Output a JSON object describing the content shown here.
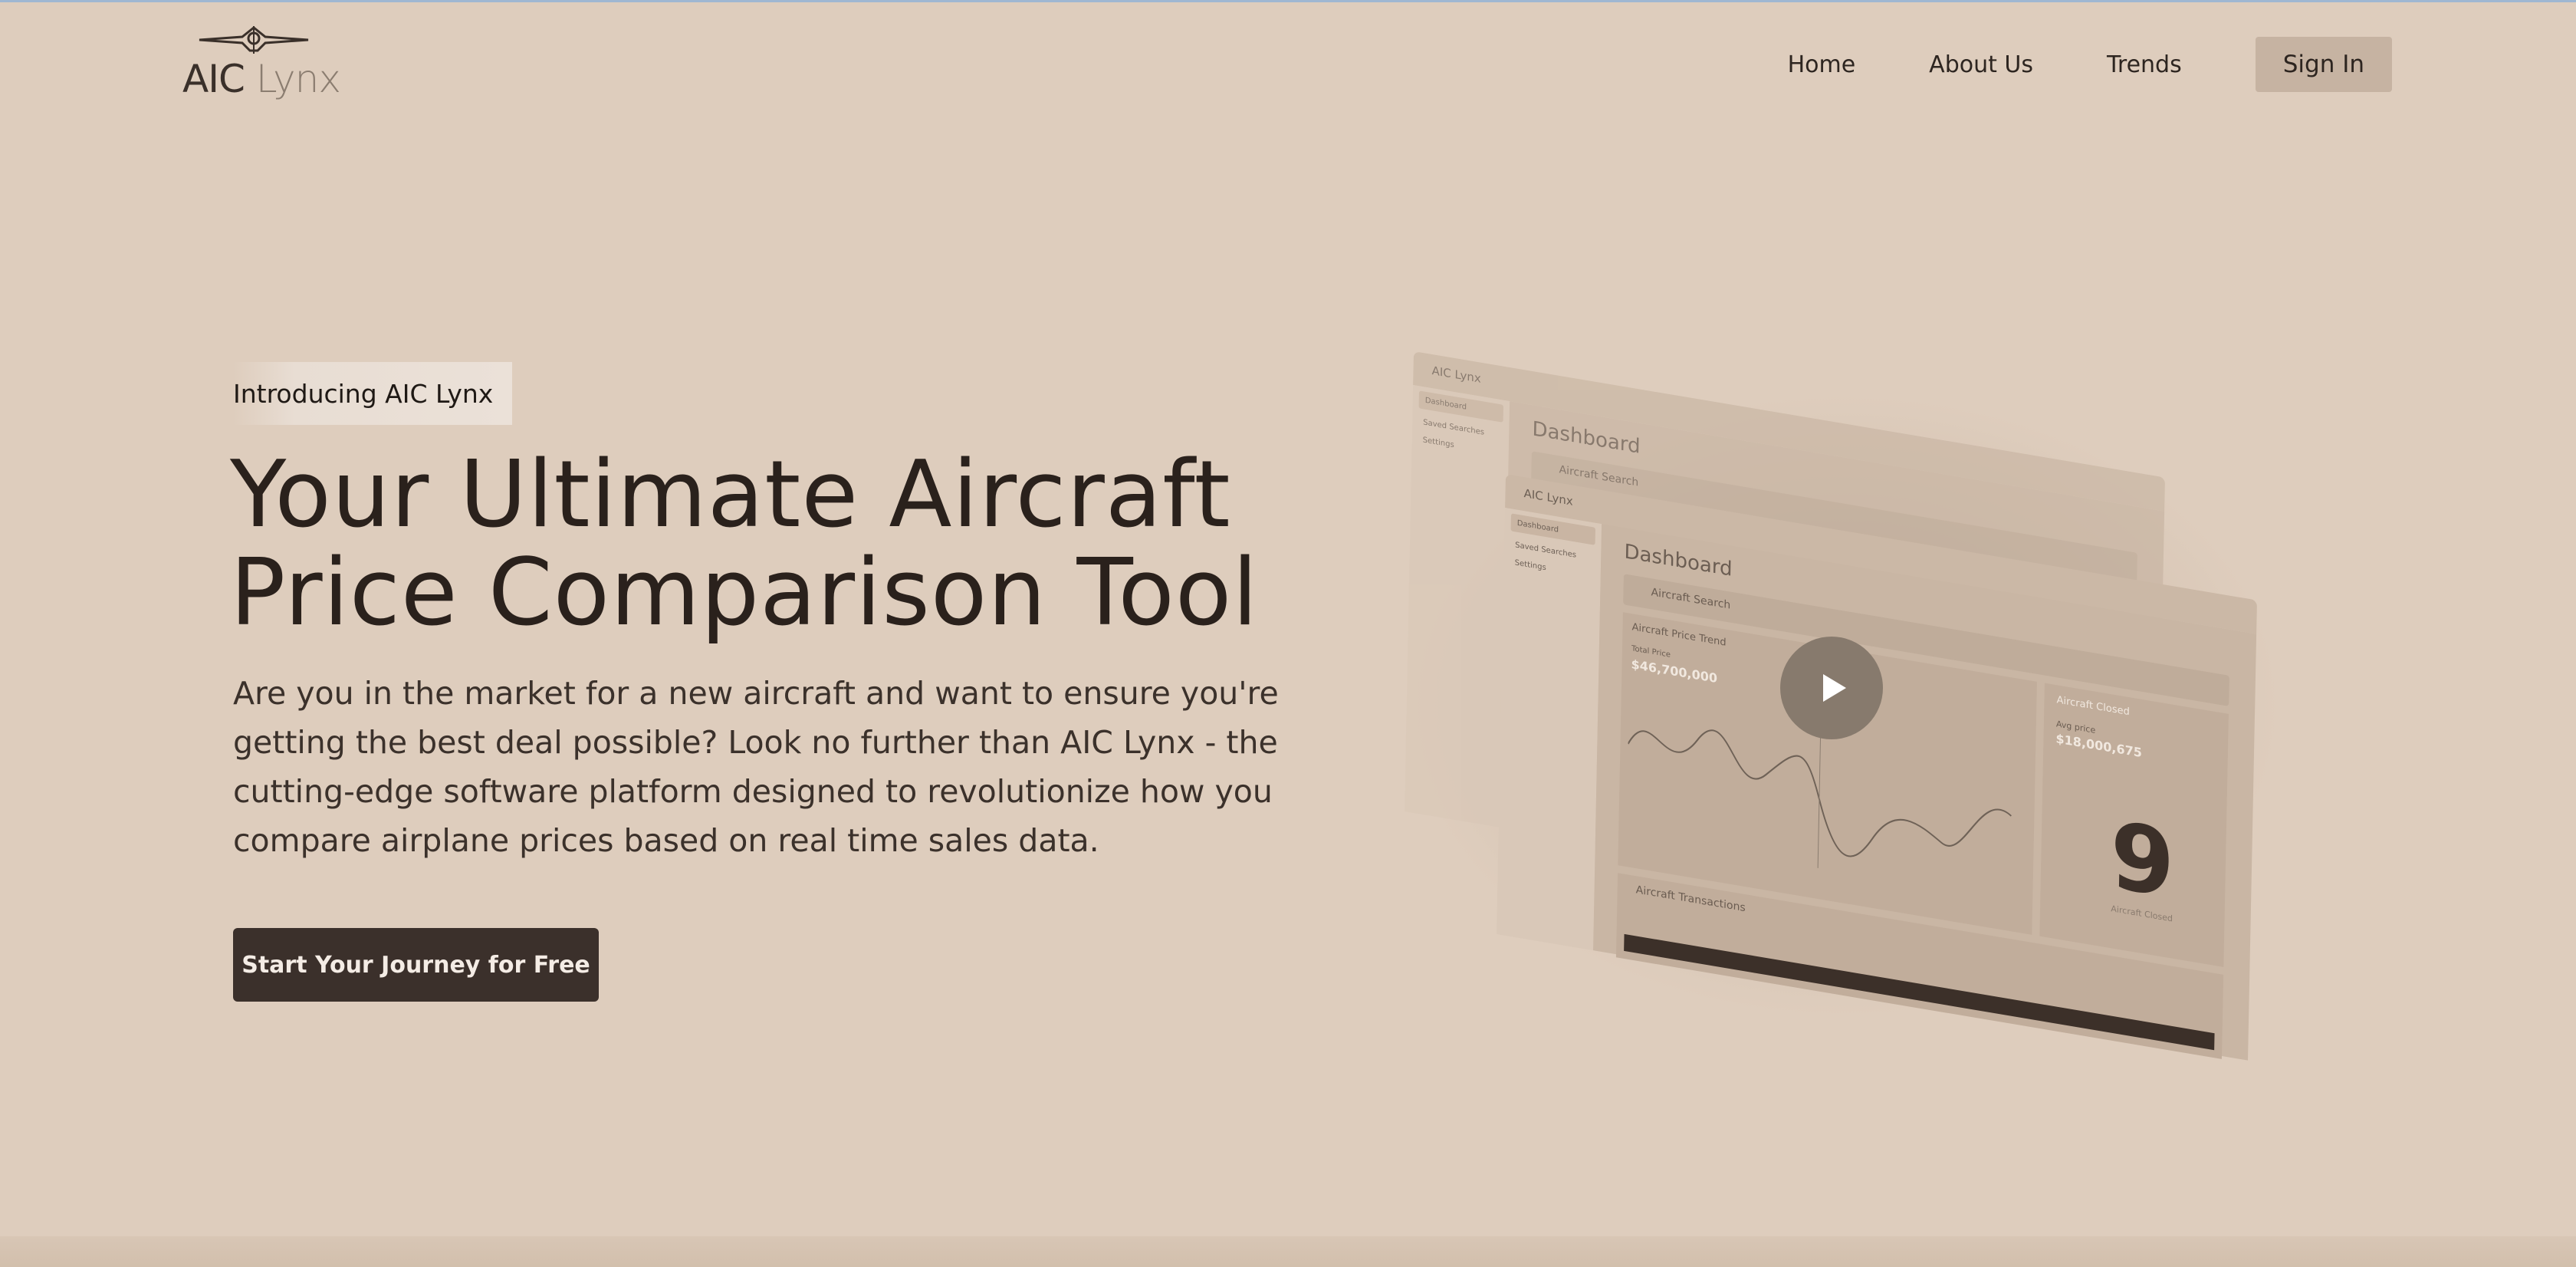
{
  "brand": {
    "name_primary": "AIC",
    "name_secondary": "Lynx"
  },
  "nav": {
    "links": [
      "Home",
      "About Us",
      "Trends"
    ],
    "sign_in": "Sign In"
  },
  "hero": {
    "badge": "Introducing AIC Lynx",
    "headline_lines": [
      "Your Ultimate Aircraft",
      "Price Comparison Tool"
    ],
    "lead_lines": [
      "Are you in the market for a new aircraft and want to ensure you're",
      "getting the best deal possible? Look no further than AIC Lynx - the",
      "cutting-edge software platform designed to revolutionize how you",
      "compare airplane prices based on real time sales data."
    ],
    "cta": "Start Your Journey for Free"
  },
  "mockup": {
    "logo": "AIC Lynx",
    "sidebar": [
      "Dashboard",
      "Saved Searches",
      "Settings"
    ],
    "title": "Dashboard",
    "search_label": "Aircraft Search",
    "chart_title": "Aircraft Price Trend",
    "total_price_label": "Total Price",
    "total_price_value": "$46,700,000",
    "card_title": "Aircraft Closed",
    "avg_price_label": "Avg price",
    "avg_price_value": "$18,000,675",
    "closed_count": "9",
    "closed_caption": "Aircraft Closed",
    "table_title": "Aircraft Transactions",
    "play_label": "play-video"
  },
  "colors": {
    "background": "#decdbd",
    "cta": "#3b302b",
    "sign_in": "#c6b3a2"
  }
}
